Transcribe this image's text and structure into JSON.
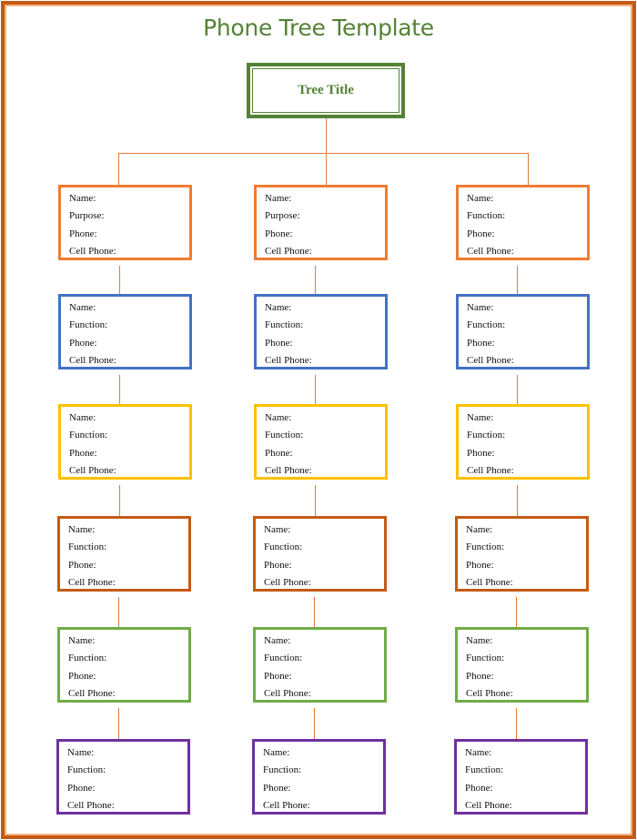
{
  "document": {
    "title": "Phone Tree Template",
    "root": {
      "label": "Tree Title"
    },
    "colors": {
      "title": "#548235",
      "frame_outer": "#C55A11",
      "frame_inner": "#F4B183",
      "connector": "#E07B39"
    },
    "rows": [
      {
        "color": "#ED7D31",
        "nodes": [
          {
            "fields": [
              "Name:",
              "Purpose:",
              "Phone:",
              "Cell Phone:"
            ]
          },
          {
            "fields": [
              "Name:",
              "Purpose:",
              "Phone:",
              "Cell Phone:"
            ]
          },
          {
            "fields": [
              "Name:",
              "Function:",
              "Phone:",
              "Cell Phone:"
            ]
          }
        ]
      },
      {
        "color": "#4472C4",
        "nodes": [
          {
            "fields": [
              "Name:",
              "Function:",
              "Phone:",
              "Cell Phone:"
            ]
          },
          {
            "fields": [
              "Name:",
              "Function:",
              "Phone:",
              "Cell Phone:"
            ]
          },
          {
            "fields": [
              "Name:",
              "Function:",
              "Phone:",
              "Cell Phone:"
            ]
          }
        ]
      },
      {
        "color": "#FFC000",
        "nodes": [
          {
            "fields": [
              "Name:",
              "Function:",
              "Phone:",
              "Cell Phone:"
            ]
          },
          {
            "fields": [
              "Name:",
              "Function:",
              "Phone:",
              "Cell Phone:"
            ]
          },
          {
            "fields": [
              "Name:",
              "Function:",
              "Phone:",
              "Cell Phone:"
            ]
          }
        ]
      },
      {
        "color": "#C55A11",
        "nodes": [
          {
            "fields": [
              "Name:",
              "Function:",
              "Phone:",
              "Cell Phone:"
            ]
          },
          {
            "fields": [
              "Name:",
              "Function:",
              "Phone:",
              "Cell Phone:"
            ]
          },
          {
            "fields": [
              "Name:",
              "Function:",
              "Phone:",
              "Cell Phone:"
            ]
          }
        ]
      },
      {
        "color": "#70AD47",
        "nodes": [
          {
            "fields": [
              "Name:",
              "Function:",
              "Phone:",
              "Cell Phone:"
            ]
          },
          {
            "fields": [
              "Name:",
              "Function:",
              "Phone:",
              "Cell Phone:"
            ]
          },
          {
            "fields": [
              "Name:",
              "Function:",
              "Phone:",
              "Cell Phone:"
            ]
          }
        ]
      },
      {
        "color": "#7030A0",
        "nodes": [
          {
            "fields": [
              "Name:",
              "Function:",
              "Phone:",
              "Cell Phone:"
            ]
          },
          {
            "fields": [
              "Name:",
              "Function:",
              "Phone:",
              "Cell Phone:"
            ]
          },
          {
            "fields": [
              "Name:",
              "Function:",
              "Phone:",
              "Cell Phone:"
            ]
          }
        ]
      }
    ]
  }
}
